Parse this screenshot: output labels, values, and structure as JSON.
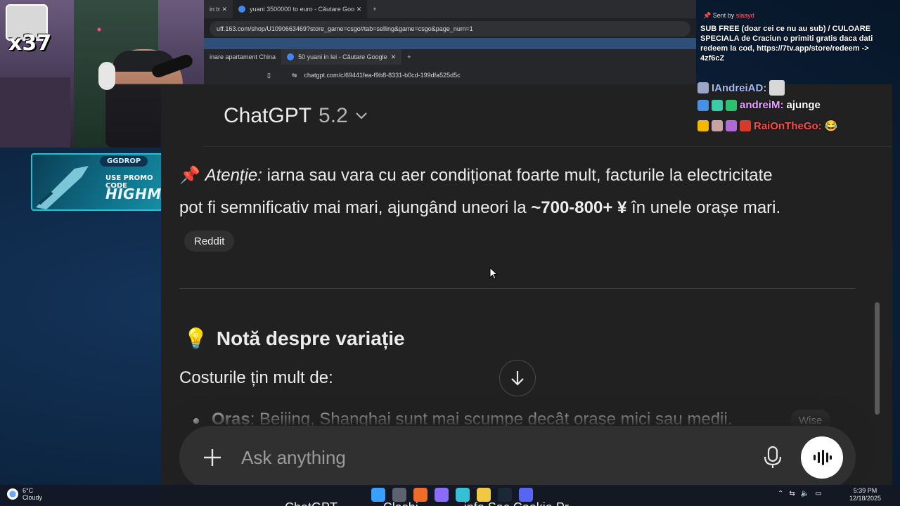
{
  "overlay": {
    "sub_multiplier": "x37",
    "promo": {
      "brand": "GGDROP",
      "label": "USE PROMO CODE",
      "code": "HIGHMAN"
    }
  },
  "browser_back": {
    "tabs": [
      "in tr",
      "yuani 3500000 to euro - Căutare Goo"
    ],
    "url": "uff.163.com/shop/U1090663469?store_game=csgo#tab=selling&game=csgo&page_num=1"
  },
  "browser_mid": {
    "tabs": [
      "inare apartament China",
      "50 yuani in lei - Căutare Google"
    ],
    "url": "chatgpt.com/c/69441fea-f9b8-8331-b0cd-199dfa525d5c"
  },
  "chatgpt": {
    "model_name": "ChatGPT",
    "model_version": "5.2",
    "attention": {
      "pin_icon": "📌",
      "label": "Atenție:",
      "text_a": "iarna sau vara cu aer condiționat foarte mult, facturile la electricitate",
      "text_b": "pot fi semnificativ mai mari, ajungând uneori la",
      "highlight": "~700-800+ ¥",
      "text_c": "în unele orașe mari."
    },
    "source_reddit": "Reddit",
    "section": {
      "icon": "💡",
      "title": "Notă despre variație"
    },
    "costs_intro": "Costurile țin mult de:",
    "bullet": {
      "label": "Oraș",
      "text": ": Beijing, Shanghai sunt mai scumpe decât orașe mici sau medii."
    },
    "source_wise": "Wise",
    "composer": {
      "placeholder": "Ask anything"
    }
  },
  "stream_chat": {
    "sent_by_prefix": "Sent by",
    "sent_by_user": "slaayd",
    "sub_message": "SUB FREE (doar cei ce nu au sub) / CULOARE SPECIALA de Craciun o primiti gratis daca dati redeem la cod, https://7tv.app/store/redeem -> 4zf6cZ",
    "messages": [
      {
        "user": "IAndreiAD:",
        "text": ""
      },
      {
        "user": "andreiM:",
        "text": "ajunge"
      },
      {
        "user": "RaiOnTheGo:",
        "text": "😂"
      }
    ]
  },
  "taskbar": {
    "weather_temp": "6°C",
    "weather_desc": "Cloudy",
    "time": "5:39 PM",
    "date": "12/18/2025"
  },
  "caption": "ChatGPT ... ... ... Clashi ... ... ... info  Sac  Cookie Pr..."
}
